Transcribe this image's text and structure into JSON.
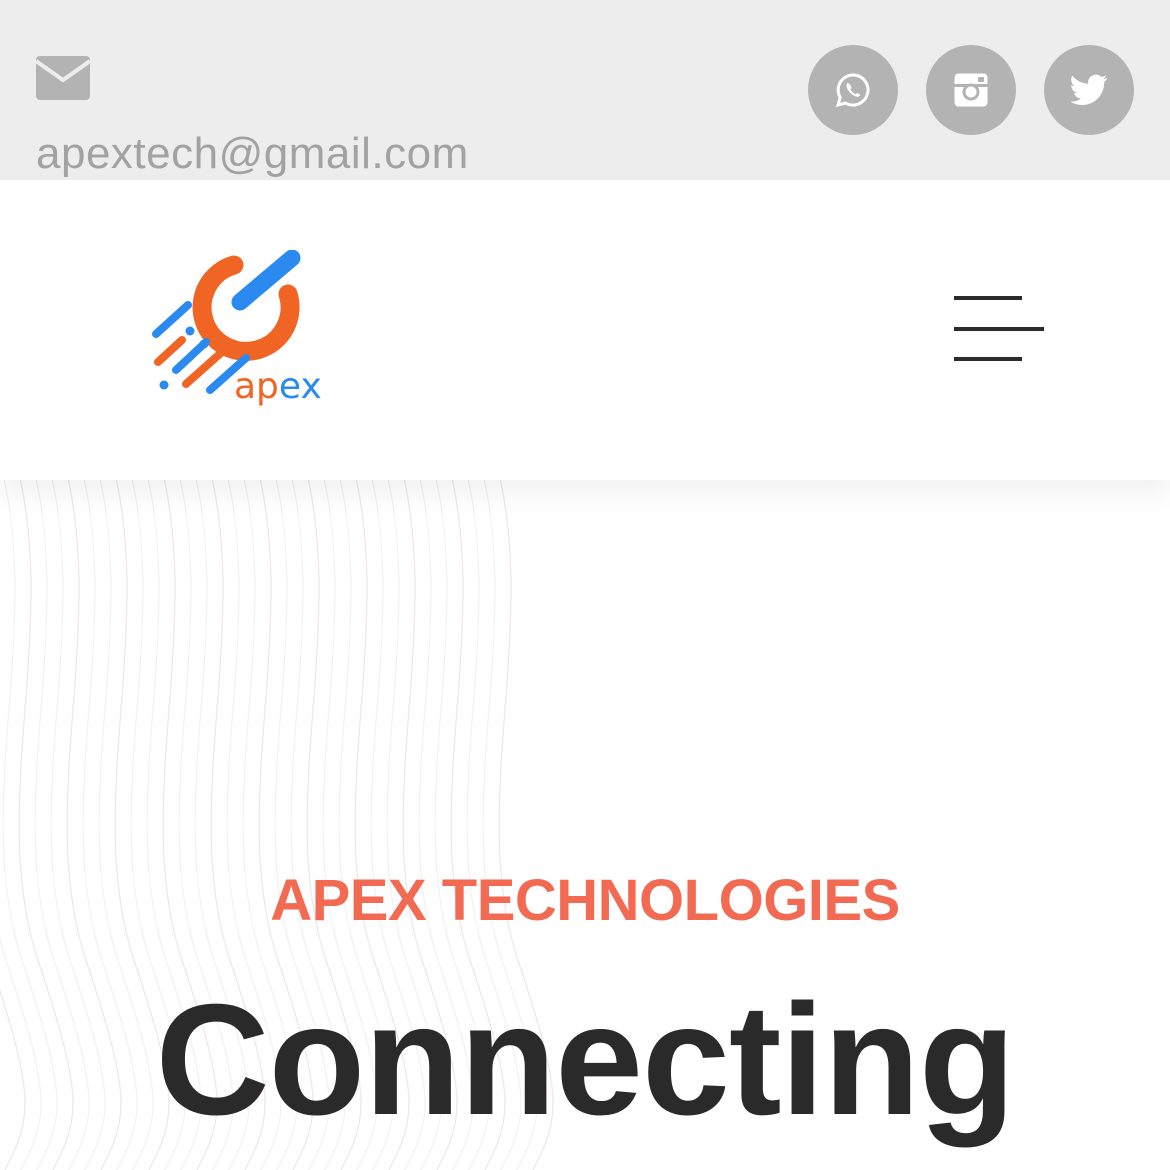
{
  "topbar": {
    "mail_icon": "envelope-icon",
    "email": "apextech@gmail.com",
    "socials": [
      {
        "name": "whatsapp",
        "icon": "whatsapp-icon"
      },
      {
        "name": "instagram",
        "icon": "instagram-icon"
      },
      {
        "name": "twitter",
        "icon": "twitter-icon"
      }
    ],
    "bg_color": "#ededed",
    "icon_circle_color": "#b3b3b3"
  },
  "header": {
    "logo": {
      "text_ap": "ap",
      "text_ex": "ex",
      "orange": "#f06523",
      "blue": "#2a8af0"
    },
    "menu_icon": "hamburger-menu-icon"
  },
  "hero": {
    "eyebrow": "APEX TECHNOLOGIES",
    "headline": "Connecting",
    "eyebrow_color": "#f26a52",
    "headline_color": "#2a2a2a"
  }
}
